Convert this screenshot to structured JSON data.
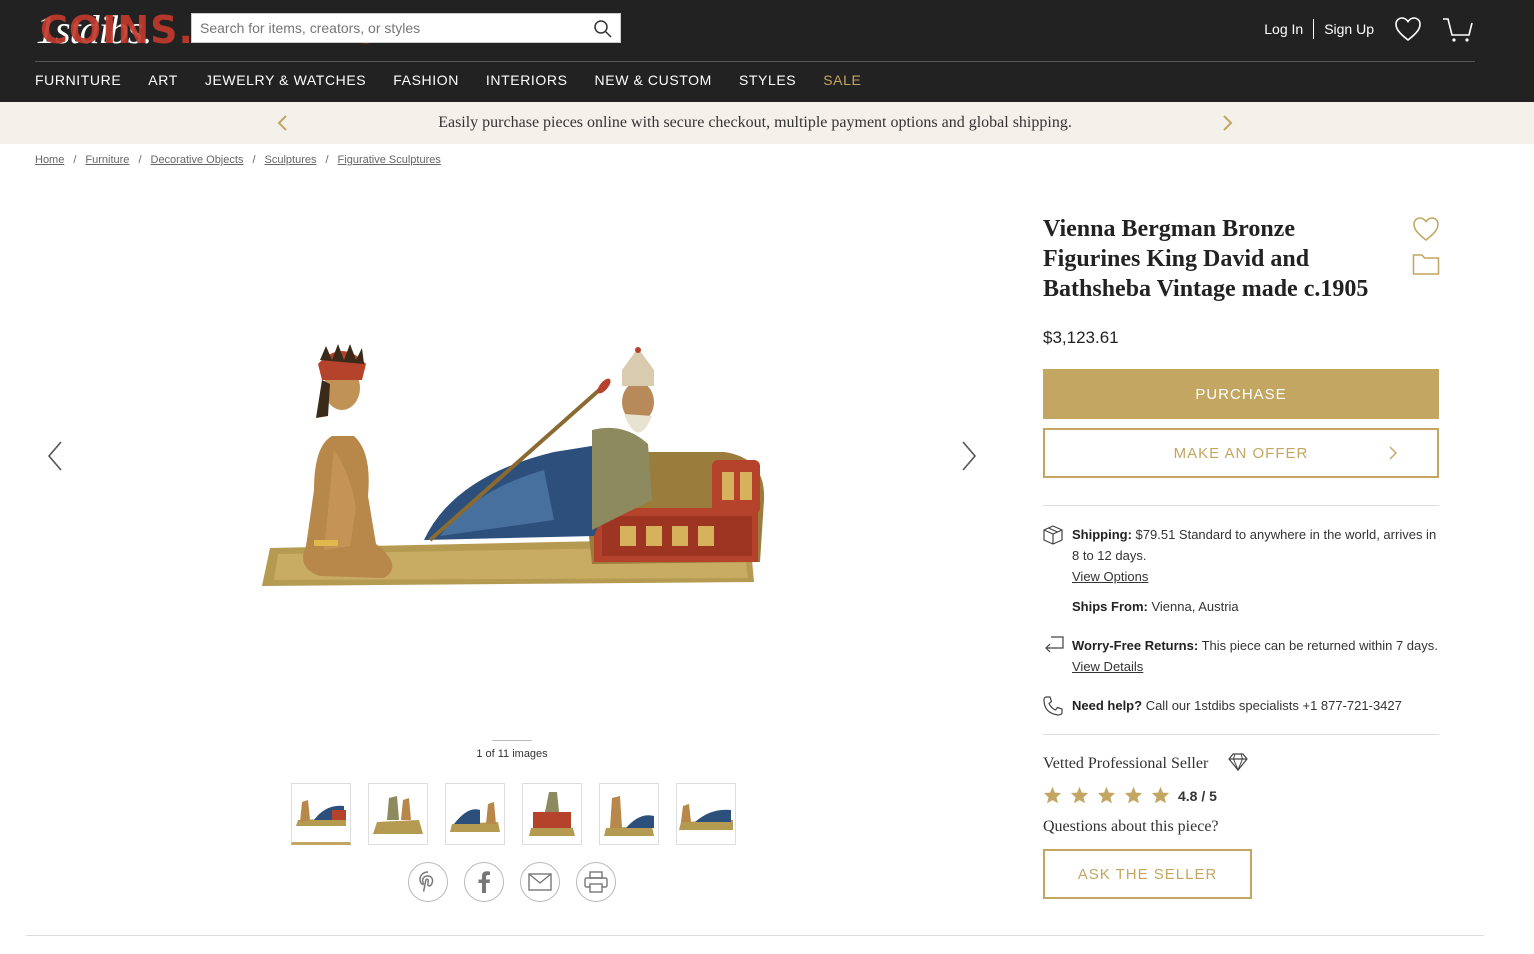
{
  "header": {
    "logo": "1stdibs.",
    "watermark": "COINS.LAVE.RU",
    "search_placeholder": "Search for items, creators, or styles",
    "login": "Log In",
    "signup": "Sign Up"
  },
  "nav": {
    "items": [
      "FURNITURE",
      "ART",
      "JEWELRY & WATCHES",
      "FASHION",
      "INTERIORS",
      "NEW & CUSTOM",
      "STYLES",
      "SALE"
    ]
  },
  "promo": {
    "text": "Easily purchase pieces online with secure checkout, multiple payment options and global shipping."
  },
  "breadcrumb": [
    "Home",
    "Furniture",
    "Decorative Objects",
    "Sculptures",
    "Figurative Sculptures"
  ],
  "gallery": {
    "counter": "1 of 11 images"
  },
  "product": {
    "title": "Vienna Bergman Bronze Figurines King David and Bathsheba Vintage made c.1905",
    "price": "$3,123.61",
    "purchase_label": "PURCHASE",
    "offer_label": "MAKE AN OFFER"
  },
  "shipping": {
    "label": "Shipping:",
    "text": " $79.51 Standard to anywhere in the world, arrives in 8 to 12 days.",
    "options_link": "View Options",
    "ships_from_label": "Ships From:",
    "ships_from": " Vienna, Austria"
  },
  "returns": {
    "label": "Worry-Free Returns:",
    "text": " This piece can be returned within 7 days. ",
    "details_link": "View Details"
  },
  "help": {
    "label": "Need help?",
    "text": " Call our 1stdibs specialists +1 877-721-3427"
  },
  "seller": {
    "label": "Vetted Professional Seller",
    "rating": "4.8 / 5",
    "rating_value": 4.8,
    "questions": "Questions about this piece?",
    "ask_label": "ASK THE SELLER"
  },
  "colors": {
    "header_bg": "#222222",
    "accent_gold": "#c2a661",
    "promo_bg": "#f4f1ea"
  }
}
